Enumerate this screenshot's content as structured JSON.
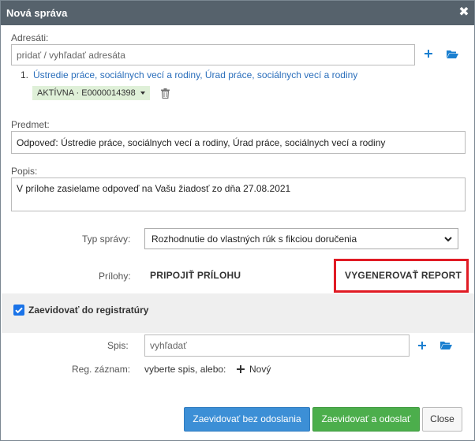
{
  "window": {
    "title": "Nová správa"
  },
  "recipients": {
    "label": "Adresáti:",
    "search_placeholder": "pridať / vyhľadať adresáta",
    "items": [
      {
        "index": "1.",
        "name": "Ústredie práce, sociálnych vecí a rodiny, Úrad práce, sociálnych vecí a rodiny",
        "status": "AKTÍVNA · E0000014398"
      }
    ]
  },
  "subject": {
    "label": "Predmet:",
    "value": "Odpoveď: Ústredie práce, sociálnych vecí a rodiny, Úrad práce, sociálnych vecí a rodiny"
  },
  "description": {
    "label": "Popis:",
    "value": "V prílohe zasielame odpoveď na Vašu žiadosť zo dňa 27.08.2021"
  },
  "message_type": {
    "label": "Typ správy:",
    "selected": "Rozhodnutie do vlastných rúk s fikciou doručenia"
  },
  "attachments": {
    "label": "Prílohy:",
    "attach_label": "PRIPOJIŤ PRÍLOHU",
    "report_label": "VYGENEROVAŤ REPORT"
  },
  "registry": {
    "checkbox_label": "Zaevidovať do registratúry",
    "checked": true,
    "file_label": "Spis:",
    "file_placeholder": "vyhľadať",
    "record_label": "Reg. záznam:",
    "record_hint": "vyberte spis, alebo:",
    "new_label": "Nový"
  },
  "footer": {
    "register_only": "Zaevidovať bez odoslania",
    "register_send": "Zaevidovať a odoslať",
    "close": "Close"
  },
  "colors": {
    "titlebar": "#56626c",
    "link": "#2a6ebb",
    "icon_blue": "#1a7fd0",
    "highlight": "#e01b24",
    "status_bg": "#dff0d8"
  }
}
